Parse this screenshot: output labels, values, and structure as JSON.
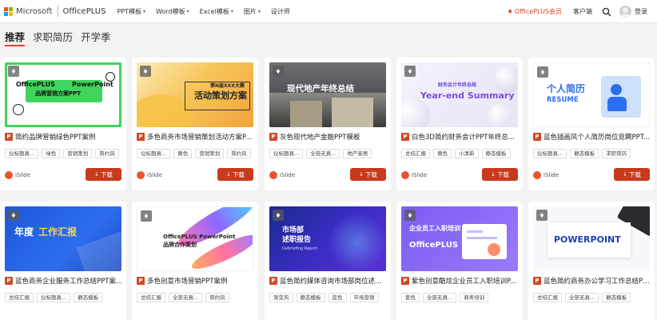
{
  "header": {
    "brand": "Microsoft",
    "product": "OfficePLUS",
    "nav": [
      {
        "label": "PPT模板",
        "has_menu": true
      },
      {
        "label": "Word模板",
        "has_menu": true
      },
      {
        "label": "Excel模板",
        "has_menu": true
      },
      {
        "label": "图片",
        "has_menu": true
      },
      {
        "label": "设计师",
        "has_menu": false
      }
    ],
    "vip": "OfficePLUS会员",
    "client": "客户端",
    "login": "登录"
  },
  "tabs": [
    "推荐",
    "求职简历",
    "开学季"
  ],
  "icons": {
    "vip": "diamond-icon",
    "search": "search-icon",
    "badge": "diamond-badge-icon",
    "type": "ppt-file-icon",
    "download": "download-arrow-icon",
    "author": "islide-logo-icon"
  },
  "colors": {
    "accent": "#d24726",
    "download_button": "#c83a1c"
  },
  "cards": [
    {
      "title": "简约品牌营销绿色PPT案例",
      "tags": [
        "仪标题真...",
        "绿色",
        "营销策划",
        "简约风"
      ],
      "author": "iSlide",
      "download": "下载",
      "thumb": {
        "lines": [
          "OfficePLUS",
          "PowerPoint",
          "品牌营销方案PPT"
        ]
      }
    },
    {
      "title": "多色商务市场营销策划活动方案P...",
      "tags": [
        "仪标题真...",
        "黄色",
        "营销策划",
        "简约风"
      ],
      "author": "iSlide",
      "download": "下载",
      "thumb": {
        "lines": [
          "第N届XXX大赛",
          "活动策划方案"
        ]
      }
    },
    {
      "title": "灰色现代地产金融PPT模板",
      "tags": [
        "仪标题真...",
        "全部无真...",
        "地产家居"
      ],
      "author": "iSlide",
      "download": "下载",
      "thumb": {
        "lines": [
          "现代地产年终总结"
        ]
      }
    },
    {
      "title": "白色3D简约财务会计PPT年终总...",
      "tags": [
        "总结汇报",
        "黄色",
        "小清新",
        "静态模板"
      ],
      "author": "iSlide",
      "download": "下载",
      "thumb": {
        "lines": [
          "财务会计年终总结",
          "Year-end Summary"
        ]
      }
    },
    {
      "title": "蓝色插画风个人简历岗位竞聘PPT...",
      "tags": [
        "仪标题真...",
        "静态模板",
        "求职简历"
      ],
      "author": "iSlide",
      "download": "下载",
      "thumb": {
        "lines": [
          "个人简历",
          "RESUME"
        ]
      }
    },
    {
      "title": "蓝色商务企业服务工作总结PPT案...",
      "tags": [
        "总结汇报",
        "仪标题真...",
        "静态模板"
      ],
      "author": "",
      "download": "",
      "thumb": {
        "lines": [
          "年度",
          "工作汇报"
        ]
      }
    },
    {
      "title": "多色创意市场营销PPT案例",
      "tags": [
        "总结汇报",
        "全部无真...",
        "简约风"
      ],
      "author": "",
      "download": "",
      "thumb": {
        "lines": [
          "OfficePLUS PowerPoint",
          "品牌合作策划"
        ]
      }
    },
    {
      "title": "蓝色简约媒体咨询市场部岗位述职...",
      "tags": [
        "渐变风",
        "静态模板",
        "蓝色",
        "市场营销"
      ],
      "author": "",
      "download": "",
      "thumb": {
        "lines": [
          "市场部",
          "述职报告",
          "Debriefing Report"
        ]
      }
    },
    {
      "title": "紫色创意酷炫企业员工入职培训P...",
      "tags": [
        "紫色",
        "全部无真...",
        "商务培训"
      ],
      "author": "",
      "download": "",
      "thumb": {
        "lines": [
          "企业员工入职培训",
          "OfficePLUS"
        ]
      }
    },
    {
      "title": "蓝色简约商务办公学习工作总结PPT...",
      "tags": [
        "总结汇报",
        "全部无真...",
        "静态模板"
      ],
      "author": "",
      "download": "",
      "thumb": {
        "lines": [
          "POWERPOINT"
        ]
      }
    }
  ]
}
